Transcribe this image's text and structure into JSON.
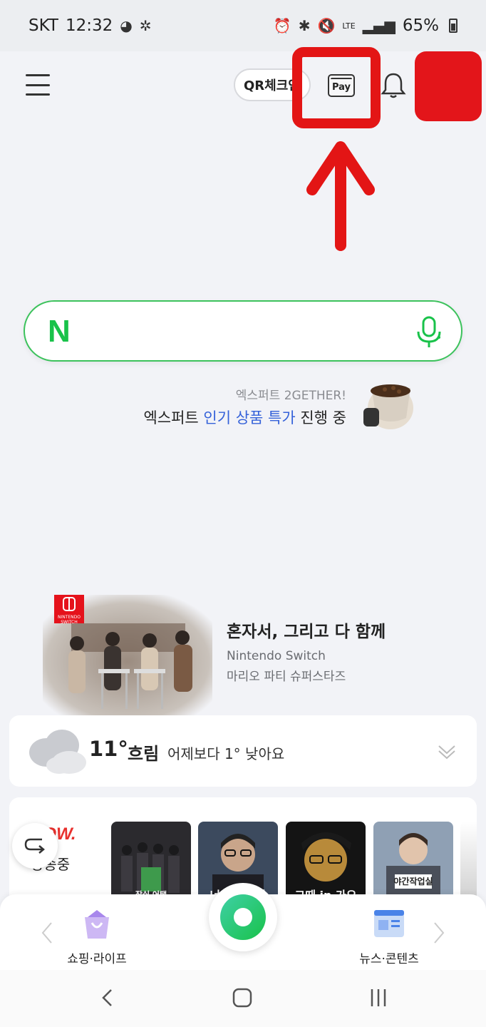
{
  "status_bar": {
    "carrier": "SKT",
    "time": "12:32",
    "network": "LTE",
    "battery": "65%"
  },
  "header": {
    "qr_label": "QR체크인",
    "pay_label": "Pay"
  },
  "promo": {
    "subtitle": "엑스퍼트 2GETHER!",
    "main_prefix": "엑스퍼트 ",
    "main_highlight": "인기 상품 특가",
    "main_suffix": " 진행 중"
  },
  "banner": {
    "logo_text": "NINTENDO SWITCH",
    "title": "혼자서, 그리고 다 함께",
    "line1": "Nintendo Switch",
    "line2": "마리오 파티 슈퍼스타즈"
  },
  "weather": {
    "temperature": "11°",
    "condition": "흐림",
    "comparison": "어제보다 1° 낮아요"
  },
  "now_card": {
    "logo": "NOW.",
    "live_label": "방송중",
    "thumbnails": [
      {
        "label": "잠실 어택"
      },
      {
        "label": "너에게 음악"
      },
      {
        "label": "그때 in 가요"
      },
      {
        "label": "야간작업실"
      }
    ]
  },
  "dock": {
    "left_label": "쇼핑·라이프",
    "right_label": "뉴스·콘텐츠"
  },
  "colors": {
    "naver_green": "#19c24a",
    "highlight_blue": "#3562d9",
    "annotation_red": "#e31515"
  }
}
